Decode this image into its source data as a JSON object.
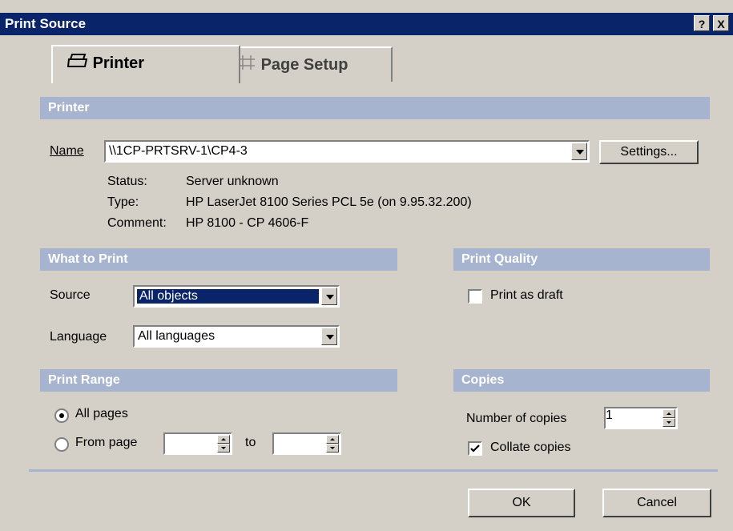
{
  "window": {
    "title": "Print Source",
    "help_label": "?",
    "close_label": "X"
  },
  "tabs": [
    {
      "label": "Printer"
    },
    {
      "label": "Page Setup"
    }
  ],
  "printer": {
    "section": "Printer",
    "name_label": "Name",
    "name_value": "\\\\1CP-PRTSRV-1\\CP4-3",
    "settings_label": "Settings...",
    "status_label": "Status:",
    "status_value": "Server unknown",
    "type_label": "Type:",
    "type_value": "HP LaserJet 8100 Series PCL 5e (on 9.95.32.200)",
    "comment_label": "Comment:",
    "comment_value": "HP 8100 - CP 4606-F"
  },
  "what_to_print": {
    "section": "What to Print",
    "source_label": "Source",
    "source_value": "All objects",
    "language_label": "Language",
    "language_value": "All languages"
  },
  "print_quality": {
    "section": "Print Quality",
    "draft_label": "Print as draft",
    "draft_checked": false
  },
  "print_range": {
    "section": "Print Range",
    "all_pages_label": "All pages",
    "all_pages_selected": true,
    "from_page_label": "From page",
    "from_value": "",
    "to_label": "to",
    "to_value": ""
  },
  "copies": {
    "section": "Copies",
    "number_label": "Number of copies",
    "number_value": "1",
    "collate_label": "Collate copies",
    "collate_checked": true
  },
  "buttons": {
    "ok": "OK",
    "cancel": "Cancel"
  }
}
